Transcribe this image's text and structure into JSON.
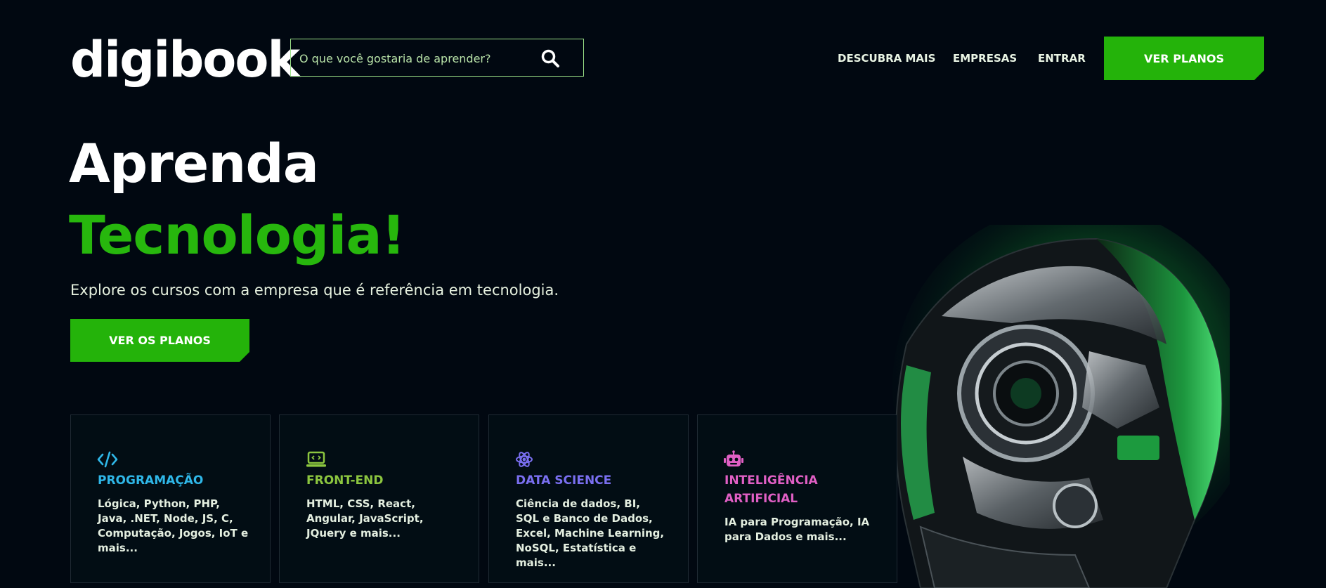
{
  "header": {
    "logo": "digibook",
    "search": {
      "placeholder": "O que você gostaria de aprender?",
      "value": ""
    },
    "nav": [
      "DESCUBRA MAIS",
      "EMPRESAS",
      "ENTRAR"
    ],
    "cta_label": "VER PLANOS"
  },
  "hero": {
    "title_line1": "Aprenda",
    "title_line2": "Tecnologia!",
    "subtitle": "Explore os cursos com a empresa que é referência em tecnologia.",
    "cta_label": "VER OS PLANOS"
  },
  "cards": [
    {
      "icon": "code-icon",
      "title": "PROGRAMAÇÃO",
      "description": "Lógica, Python, PHP, Java, .NET, Node, JS, C, Computação, Jogos, IoT e mais...",
      "color": "#2fb7e8"
    },
    {
      "icon": "laptop-code-icon",
      "title": "FRONT-END",
      "description": "HTML, CSS, React, Angular, JavaScript, JQuery e mais...",
      "color": "#8cc63f"
    },
    {
      "icon": "atom-icon",
      "title": "DATA SCIENCE",
      "description": "Ciência de dados, BI, SQL e Banco de Dados, Excel, Machine Learning, NoSQL, Estatística e mais...",
      "color": "#7a6ff0"
    },
    {
      "icon": "robot-icon",
      "title": "INTELIGÊNCIA ARTIFICIAL",
      "description": "IA para Programação, IA para Dados e mais...",
      "color": "#e05fc4"
    }
  ],
  "colors": {
    "background": "#010811",
    "accent": "#24b30a",
    "headline_green": "#27b70d"
  }
}
